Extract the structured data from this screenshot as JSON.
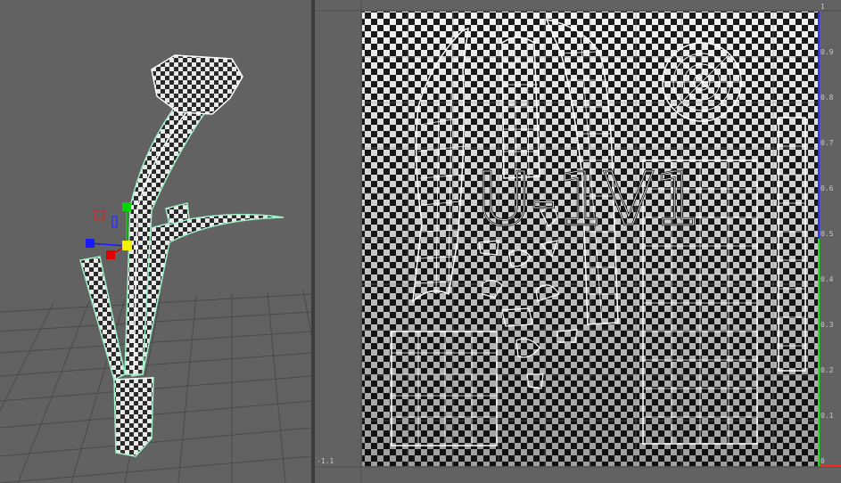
{
  "viewport_3d": {
    "name": "perspective-viewport",
    "manipulator": {
      "x_axis_color": "#e00000",
      "y_axis_color": "#00d800",
      "z_axis_color": "#1a1aff",
      "center_color": "#f2f200"
    },
    "wire_color": "#9ff0c8"
  },
  "uv_editor": {
    "tile_label": "U-1V1",
    "origin_label": "-1.1",
    "v_ticks": [
      "1",
      "0.9",
      "0.8",
      "0.7",
      "0.6",
      "0.5",
      "0.4",
      "0.3",
      "0.2",
      "0.1",
      "0"
    ],
    "colors": {
      "u_axis": "#ff2020",
      "v_axis_upper": "#3030ff",
      "v_axis_lower": "#20e020",
      "shells": "#ffffff"
    }
  }
}
